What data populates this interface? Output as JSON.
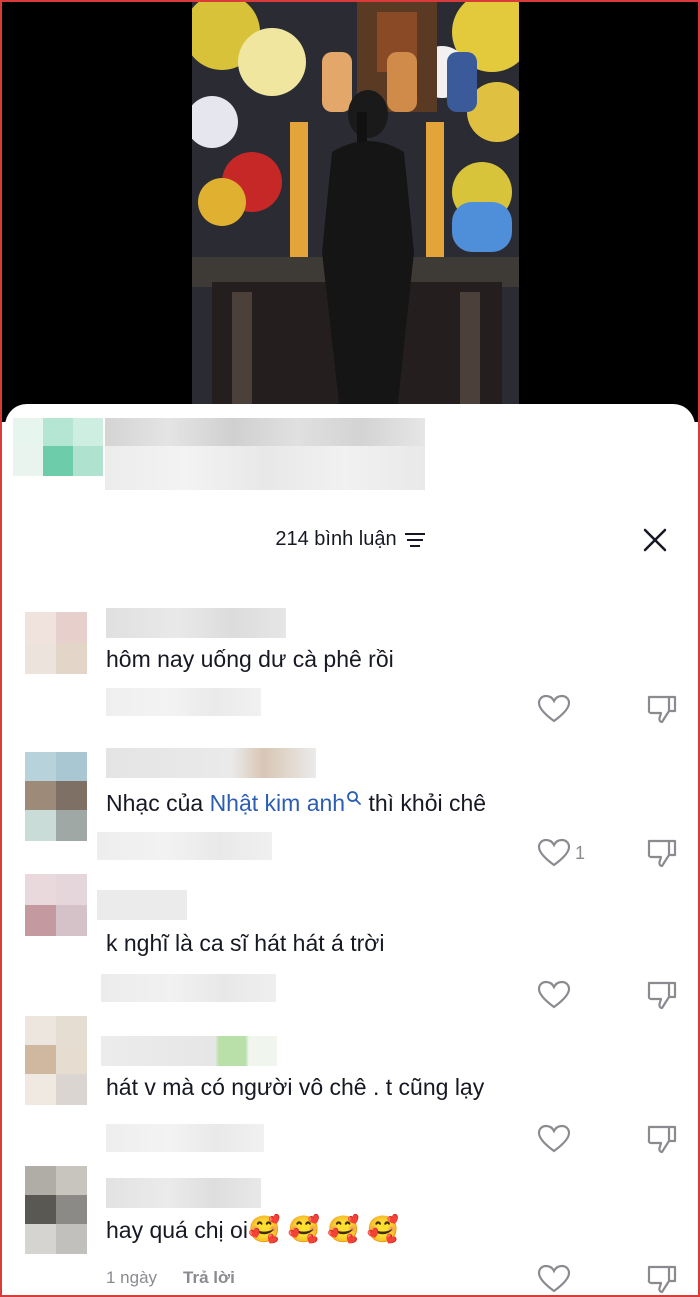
{
  "sheet": {
    "comment_count_label": "214 bình luận"
  },
  "comments": [
    {
      "text": "hôm nay uống dư cà phê rồi"
    },
    {
      "text_before": "Nhạc của ",
      "mention": "Nhật kim anh",
      "text_after": " thì khỏi chê",
      "likes": "1"
    },
    {
      "text": "k nghĩ là ca sĩ hát hát á trời"
    },
    {
      "text": "hát v mà có người vô chê . t cũng lạy"
    },
    {
      "text": "hay quá chị oi",
      "emojis": "🥰 🥰 🥰 🥰",
      "time": "1 ngày",
      "reply": "Trả lời"
    }
  ]
}
